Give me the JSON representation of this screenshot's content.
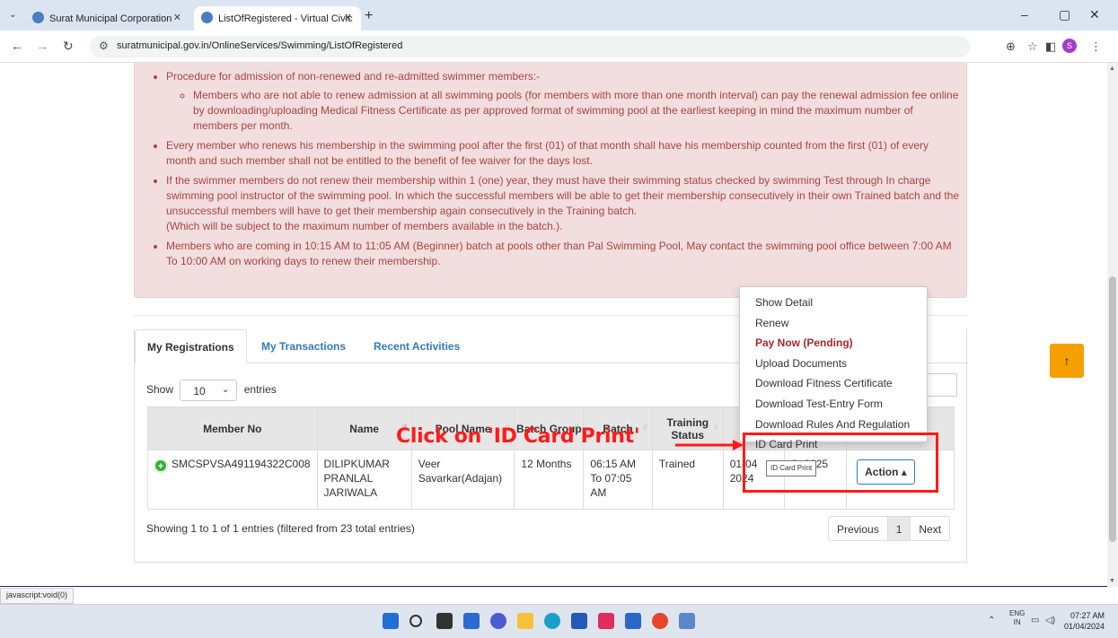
{
  "browser": {
    "tabs": [
      {
        "title": "Surat Municipal Corporation"
      },
      {
        "title": "ListOfRegistered - Virtual Civic"
      }
    ],
    "url": "suratmunicipal.gov.in/OnlineServices/Swimming/ListOfRegistered"
  },
  "notice": {
    "items": [
      {
        "text": "Procedure for admission of non-renewed and re-admitted swimmer members:-",
        "sub": "Members who are not able to renew admission at all swimming pools (for members with more than one month interval) can pay the renewal admission fee online by downloading/uploading Medical Fitness Certificate as per approved format of swimming pool at the earliest keeping in mind the maximum number of members per month."
      },
      {
        "text": "Every member who renews his membership in the swimming pool after the first (01) of that month shall have his membership counted from the first (01) of every month and such member shall not be entitled to the benefit of fee waiver for the days lost."
      },
      {
        "text": "If the swimmer members do not renew their membership within 1 (one) year, they must have their swimming status checked by swimming Test through In charge swimming pool instructor of the swimming pool. In which the successful members will be able to get their membership consecutively in their own Trained batch and the unsuccessful members will have to get their membership again consecutively in the Training batch.",
        "extra": "(Which will be subject to the maximum number of members available in the batch.)."
      },
      {
        "text": "Members who are coming in 10:15 AM to 11:05 AM (Beginner) batch at pools other than Pal Swimming Pool, May contact the swimming pool office between 7:00 AM To 10:00 AM on working days to renew their membership."
      }
    ]
  },
  "tabs": {
    "my_registrations": "My Registrations",
    "my_transactions": "My Transactions",
    "recent_activities": "Recent Activities"
  },
  "table": {
    "show_label": "Show",
    "entries_value": "10",
    "entries_label": "entries",
    "headers": [
      "Member No",
      "Name",
      "Pool Name",
      "Batch Group",
      "Batch",
      "Training Status",
      "",
      "",
      ""
    ],
    "row": {
      "member_no": "SMCSPVSA491194322C008",
      "name": "DILIPKUMAR PRANLAL JARIWALA",
      "pool_name": "Veer Savarkar(Adajan)",
      "batch_group": "12 Months",
      "batch": "06:15 AM To 07:05 AM",
      "training_status": "Trained",
      "from_date": "01-04 2024",
      "to_date": "3- 2025",
      "action": "Action"
    },
    "summary": "Showing 1 to 1 of 1 entries (filtered from 23 total entries)",
    "pager": {
      "previous": "Previous",
      "page": "1",
      "next": "Next"
    }
  },
  "action_menu": {
    "items": [
      "Show Detail",
      "Renew",
      "Pay Now (Pending)",
      "Upload Documents",
      "Download Fitness Certificate",
      "Download Test-Entry Form",
      "Download Rules And Regulation",
      "ID Card Print"
    ],
    "tooltip": "ID Card Print"
  },
  "annotation": {
    "text": "Click on 'ID Card Print'",
    "color": "#ff1a1a"
  },
  "status_url": "javascript:void(0)",
  "taskbar": {
    "lang_top": "ENG",
    "lang_bottom": "IN",
    "time": "07:27 AM",
    "date": "01/04/2024"
  },
  "colors": {
    "notice_bg": "#f2dede",
    "notice_text": "#a94442",
    "link": "#337ab7",
    "scroll_top_btn": "#f59f00"
  }
}
